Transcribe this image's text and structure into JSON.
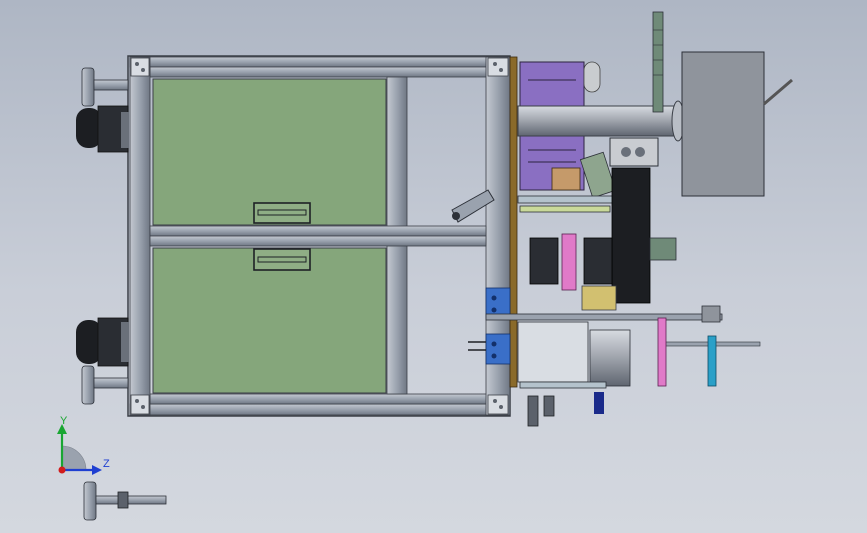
{
  "viewport": {
    "name": "cad-3d-viewport"
  },
  "triad": {
    "y_label": "Y",
    "z_label": "Z"
  },
  "colors": {
    "frame_steel": "#9aa2ae",
    "drawer_green": "#85a67b",
    "motor_purple": "#8a6fc2",
    "cylinder_gray": "#8f949c",
    "connector_blue": "#3a6fc8",
    "pink_rod": "#e07ac8",
    "cyan_rod": "#2aa0c8",
    "bronze_plate": "#8a6a2a"
  }
}
